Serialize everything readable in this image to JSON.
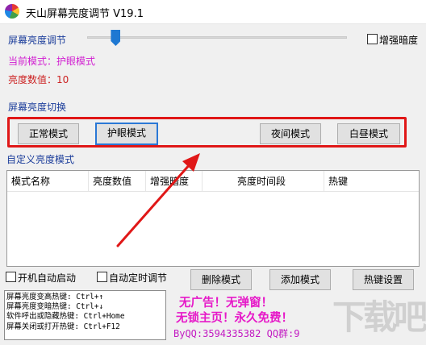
{
  "window": {
    "title": "天山屏幕亮度调节 V19.1"
  },
  "brightness": {
    "label": "屏幕亮度调节",
    "slider_fraction": 0.11,
    "enhance_label": "增强暗度",
    "current_mode": "当前模式：护眼模式",
    "value_text": "亮度数值：10"
  },
  "switch": {
    "label": "屏幕亮度切换",
    "buttons": [
      "正常模式",
      "护眼模式",
      "夜间模式",
      "白昼模式"
    ]
  },
  "custom": {
    "label": "自定义亮度模式",
    "columns": [
      "模式名称",
      "亮度数值",
      "增强暗度",
      "亮度时间段",
      "热键"
    ]
  },
  "options": {
    "autostart": "开机自动启动",
    "autotimer": "自动定时调节"
  },
  "actions": {
    "delete": "删除模式",
    "add": "添加模式",
    "hotkeys": "热键设置"
  },
  "hotkeys_info": [
    "屏幕亮度变高热键: Ctrl+↑",
    "屏幕亮度变暗热键: Ctrl+↓",
    "软件呼出或隐藏热键: Ctrl+Home",
    "屏幕关闭或打开热键: Ctrl+F12"
  ],
  "promo": {
    "line1": "无广告！无弹窗！",
    "line2": "无锁主页！永久免费！",
    "contact": "ByQQ:3594335382 QQ群:9"
  },
  "watermark": "下载吧",
  "colors": {
    "accent": "#1e78d2",
    "annotation": "#e01717",
    "promo": "#e619c8"
  }
}
